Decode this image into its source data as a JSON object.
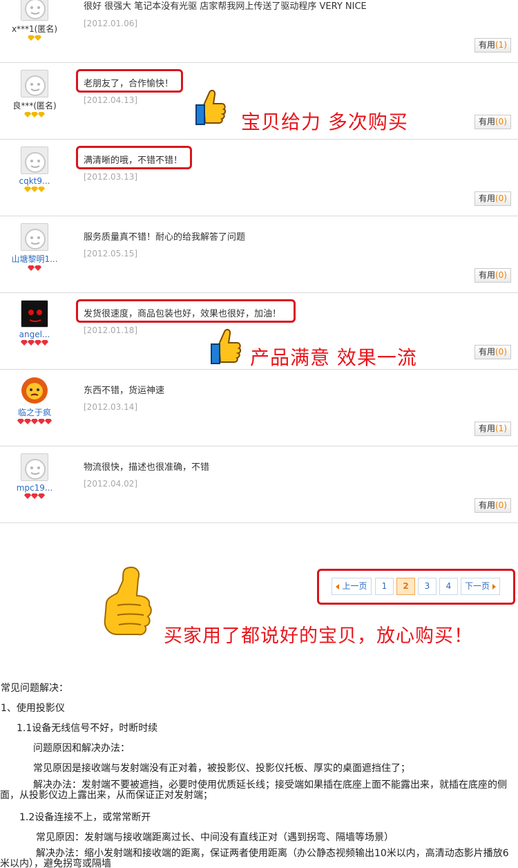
{
  "reviews": [
    {
      "user": "x***1(匿名)",
      "user_link": false,
      "badge_color": "gold",
      "badge_count": 2,
      "avatar": "default-avatar",
      "comment": "很好 很强大 笔记本没有光驱 店家帮我网上传送了驱动程序 VERY NICE",
      "date": "[2012.01.06]",
      "useful_label": "有用",
      "useful_count": "(1)",
      "highlight": false
    },
    {
      "user": "良***(匿名)",
      "user_link": false,
      "badge_color": "gold",
      "badge_count": 3,
      "avatar": "default-avatar",
      "comment": "老朋友了，合作愉快！",
      "date": "[2012.04.13]",
      "useful_label": "有用",
      "useful_count": "(0)",
      "highlight": true
    },
    {
      "user": "cqkt9...",
      "user_link": true,
      "badge_color": "gold",
      "badge_count": 3,
      "avatar": "default-avatar",
      "comment": "满清晰的哦，不错不错！",
      "date": "[2012.03.13]",
      "useful_label": "有用",
      "useful_count": "(0)",
      "highlight": true
    },
    {
      "user": "山塘黎明1...",
      "user_link": true,
      "badge_color": "red",
      "badge_count": 2,
      "avatar": "default-avatar",
      "comment": "服务质量真不错！耐心的给我解答了问题",
      "date": "[2012.05.15]",
      "useful_label": "有用",
      "useful_count": "(0)",
      "highlight": false
    },
    {
      "user": "angel...",
      "user_link": true,
      "badge_color": "red",
      "badge_count": 4,
      "avatar": "dark-face-avatar",
      "comment": "发货很速度，商品包装也好，效果也很好，加油！",
      "date": "[2012.01.18]",
      "useful_label": "有用",
      "useful_count": "(0)",
      "highlight": true
    },
    {
      "user": "临之于疯",
      "user_link": true,
      "badge_color": "red",
      "badge_count": 5,
      "avatar": "lion-avatar",
      "comment": "东西不错，货运神速",
      "date": "[2012.03.14]",
      "useful_label": "有用",
      "useful_count": "(1)",
      "highlight": false
    },
    {
      "user": "mpc19...",
      "user_link": true,
      "badge_color": "red",
      "badge_count": 3,
      "avatar": "default-avatar",
      "comment": "物流很快，描述也很准确，不错",
      "date": "[2012.04.02]",
      "useful_label": "有用",
      "useful_count": "(0)",
      "highlight": false
    }
  ],
  "promo": {
    "line1": "宝贝给力  多次购买",
    "line2": "产品满意  效果一流",
    "line3": "买家用了都说好的宝贝，放心购买！"
  },
  "pager": {
    "prev": "上一页",
    "pages": [
      "1",
      "2",
      "3",
      "4"
    ],
    "current": "2",
    "next": "下一页"
  },
  "faq": {
    "title": "常见问题解决：",
    "section1": "1、使用投影仪",
    "item1_1": "1.1设备无线信号不好，时断时续",
    "cause_label": "问题原因和解决办法：",
    "cause_1_1": "常见原因是接收端与发射端没有正对着，被投影仪、投影仪托板、厚实的桌面遮挡住了；",
    "solution_1_1": "解决办法：发射端不要被遮挡，必要时使用优质延长线；接受端如果插在底座上面不能露出来，就插在底座的侧面，从投影仪边上露出来，从而保证正对发射端；",
    "item1_2": "1.2设备连接不上，或常常断开",
    "cause_1_2": "常见原因：发射端与接收端距离过长、中间没有直线正对（遇到拐弯、隔墙等场景）",
    "solution_1_2": "解决办法：缩小发射端和接收端的距离，保证两者使用距离（办公静态视频输出10米以内，高清动态影片播放6米以内），避免拐弯或隔墙"
  },
  "colors": {
    "accent_red": "#d8151c",
    "useful_count": "#e9820c",
    "link_blue": "#2b6bbf",
    "date_gray": "#a8a8a8"
  }
}
